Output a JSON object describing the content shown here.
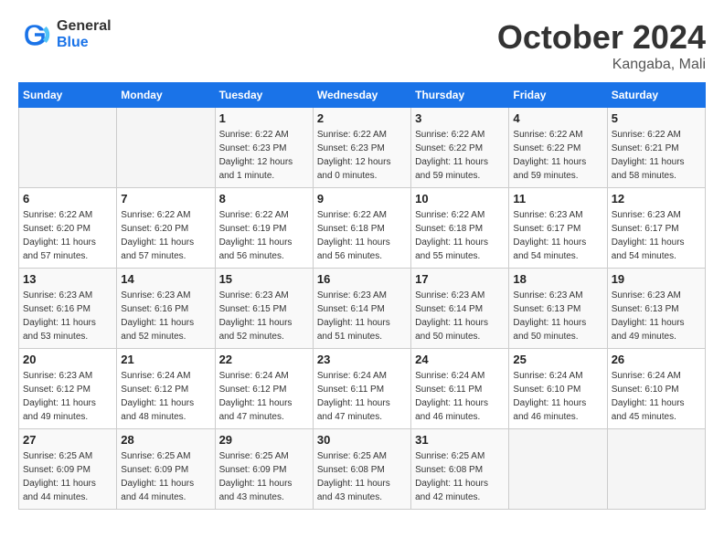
{
  "header": {
    "logo_line1": "General",
    "logo_line2": "Blue",
    "month": "October 2024",
    "location": "Kangaba, Mali"
  },
  "weekdays": [
    "Sunday",
    "Monday",
    "Tuesday",
    "Wednesday",
    "Thursday",
    "Friday",
    "Saturday"
  ],
  "weeks": [
    [
      {
        "day": "",
        "info": ""
      },
      {
        "day": "",
        "info": ""
      },
      {
        "day": "1",
        "info": "Sunrise: 6:22 AM\nSunset: 6:23 PM\nDaylight: 12 hours\nand 1 minute."
      },
      {
        "day": "2",
        "info": "Sunrise: 6:22 AM\nSunset: 6:23 PM\nDaylight: 12 hours\nand 0 minutes."
      },
      {
        "day": "3",
        "info": "Sunrise: 6:22 AM\nSunset: 6:22 PM\nDaylight: 11 hours\nand 59 minutes."
      },
      {
        "day": "4",
        "info": "Sunrise: 6:22 AM\nSunset: 6:22 PM\nDaylight: 11 hours\nand 59 minutes."
      },
      {
        "day": "5",
        "info": "Sunrise: 6:22 AM\nSunset: 6:21 PM\nDaylight: 11 hours\nand 58 minutes."
      }
    ],
    [
      {
        "day": "6",
        "info": "Sunrise: 6:22 AM\nSunset: 6:20 PM\nDaylight: 11 hours\nand 57 minutes."
      },
      {
        "day": "7",
        "info": "Sunrise: 6:22 AM\nSunset: 6:20 PM\nDaylight: 11 hours\nand 57 minutes."
      },
      {
        "day": "8",
        "info": "Sunrise: 6:22 AM\nSunset: 6:19 PM\nDaylight: 11 hours\nand 56 minutes."
      },
      {
        "day": "9",
        "info": "Sunrise: 6:22 AM\nSunset: 6:18 PM\nDaylight: 11 hours\nand 56 minutes."
      },
      {
        "day": "10",
        "info": "Sunrise: 6:22 AM\nSunset: 6:18 PM\nDaylight: 11 hours\nand 55 minutes."
      },
      {
        "day": "11",
        "info": "Sunrise: 6:23 AM\nSunset: 6:17 PM\nDaylight: 11 hours\nand 54 minutes."
      },
      {
        "day": "12",
        "info": "Sunrise: 6:23 AM\nSunset: 6:17 PM\nDaylight: 11 hours\nand 54 minutes."
      }
    ],
    [
      {
        "day": "13",
        "info": "Sunrise: 6:23 AM\nSunset: 6:16 PM\nDaylight: 11 hours\nand 53 minutes."
      },
      {
        "day": "14",
        "info": "Sunrise: 6:23 AM\nSunset: 6:16 PM\nDaylight: 11 hours\nand 52 minutes."
      },
      {
        "day": "15",
        "info": "Sunrise: 6:23 AM\nSunset: 6:15 PM\nDaylight: 11 hours\nand 52 minutes."
      },
      {
        "day": "16",
        "info": "Sunrise: 6:23 AM\nSunset: 6:14 PM\nDaylight: 11 hours\nand 51 minutes."
      },
      {
        "day": "17",
        "info": "Sunrise: 6:23 AM\nSunset: 6:14 PM\nDaylight: 11 hours\nand 50 minutes."
      },
      {
        "day": "18",
        "info": "Sunrise: 6:23 AM\nSunset: 6:13 PM\nDaylight: 11 hours\nand 50 minutes."
      },
      {
        "day": "19",
        "info": "Sunrise: 6:23 AM\nSunset: 6:13 PM\nDaylight: 11 hours\nand 49 minutes."
      }
    ],
    [
      {
        "day": "20",
        "info": "Sunrise: 6:23 AM\nSunset: 6:12 PM\nDaylight: 11 hours\nand 49 minutes."
      },
      {
        "day": "21",
        "info": "Sunrise: 6:24 AM\nSunset: 6:12 PM\nDaylight: 11 hours\nand 48 minutes."
      },
      {
        "day": "22",
        "info": "Sunrise: 6:24 AM\nSunset: 6:12 PM\nDaylight: 11 hours\nand 47 minutes."
      },
      {
        "day": "23",
        "info": "Sunrise: 6:24 AM\nSunset: 6:11 PM\nDaylight: 11 hours\nand 47 minutes."
      },
      {
        "day": "24",
        "info": "Sunrise: 6:24 AM\nSunset: 6:11 PM\nDaylight: 11 hours\nand 46 minutes."
      },
      {
        "day": "25",
        "info": "Sunrise: 6:24 AM\nSunset: 6:10 PM\nDaylight: 11 hours\nand 46 minutes."
      },
      {
        "day": "26",
        "info": "Sunrise: 6:24 AM\nSunset: 6:10 PM\nDaylight: 11 hours\nand 45 minutes."
      }
    ],
    [
      {
        "day": "27",
        "info": "Sunrise: 6:25 AM\nSunset: 6:09 PM\nDaylight: 11 hours\nand 44 minutes."
      },
      {
        "day": "28",
        "info": "Sunrise: 6:25 AM\nSunset: 6:09 PM\nDaylight: 11 hours\nand 44 minutes."
      },
      {
        "day": "29",
        "info": "Sunrise: 6:25 AM\nSunset: 6:09 PM\nDaylight: 11 hours\nand 43 minutes."
      },
      {
        "day": "30",
        "info": "Sunrise: 6:25 AM\nSunset: 6:08 PM\nDaylight: 11 hours\nand 43 minutes."
      },
      {
        "day": "31",
        "info": "Sunrise: 6:25 AM\nSunset: 6:08 PM\nDaylight: 11 hours\nand 42 minutes."
      },
      {
        "day": "",
        "info": ""
      },
      {
        "day": "",
        "info": ""
      }
    ]
  ]
}
